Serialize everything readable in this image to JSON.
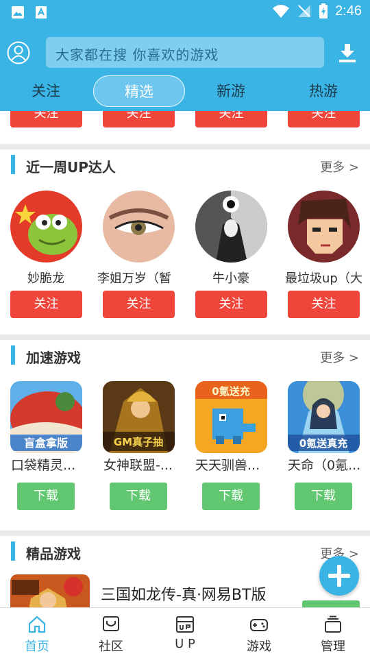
{
  "status_bar": {
    "time": "2:46"
  },
  "header": {
    "search_placeholder": "大家都在搜  你喜欢的游戏",
    "tabs": [
      {
        "label": "关注",
        "active": false
      },
      {
        "label": "精选",
        "active": true
      },
      {
        "label": "新游",
        "active": false
      },
      {
        "label": "热游",
        "active": false
      }
    ]
  },
  "top_row": {
    "follow_labels": [
      "关注",
      "关注",
      "关注",
      "关注"
    ]
  },
  "up_section": {
    "title": "近一周UP达人",
    "more": "更多 >",
    "users": [
      {
        "name": "妙脆龙",
        "follow": "关注"
      },
      {
        "name": "李姐万岁（暂",
        "follow": "关注"
      },
      {
        "name": "牛小豪",
        "follow": "关注"
      },
      {
        "name": "最垃圾up（大",
        "follow": "关注"
      }
    ]
  },
  "speed_section": {
    "title": "加速游戏",
    "more": "更多 >",
    "games": [
      {
        "name": "口袋精灵...",
        "badge": "盲盒拿版",
        "download": "下载"
      },
      {
        "name": "女神联盟-...",
        "badge": "GM真子抽",
        "download": "下载"
      },
      {
        "name": "天天驯兽...",
        "badge": "0氪送充",
        "download": "下载"
      },
      {
        "name": "天命（0氪...",
        "badge": "0氪送真充",
        "download": "下载"
      }
    ]
  },
  "premium_section": {
    "title": "精品游戏",
    "more": "更多 >",
    "featured": {
      "name": "三国如龙传-真·网易BT版"
    }
  },
  "bottom_nav": [
    {
      "label": "首页",
      "icon": "home-icon",
      "active": true
    },
    {
      "label": "社区",
      "icon": "community-icon",
      "active": false
    },
    {
      "label": "U P",
      "icon": "up-icon",
      "active": false
    },
    {
      "label": "游戏",
      "icon": "gamepad-icon",
      "active": false
    },
    {
      "label": "管理",
      "icon": "manage-icon",
      "active": false
    }
  ],
  "colors": {
    "accent": "#3ab4e4",
    "follow": "#f0453a",
    "download": "#61c871"
  }
}
